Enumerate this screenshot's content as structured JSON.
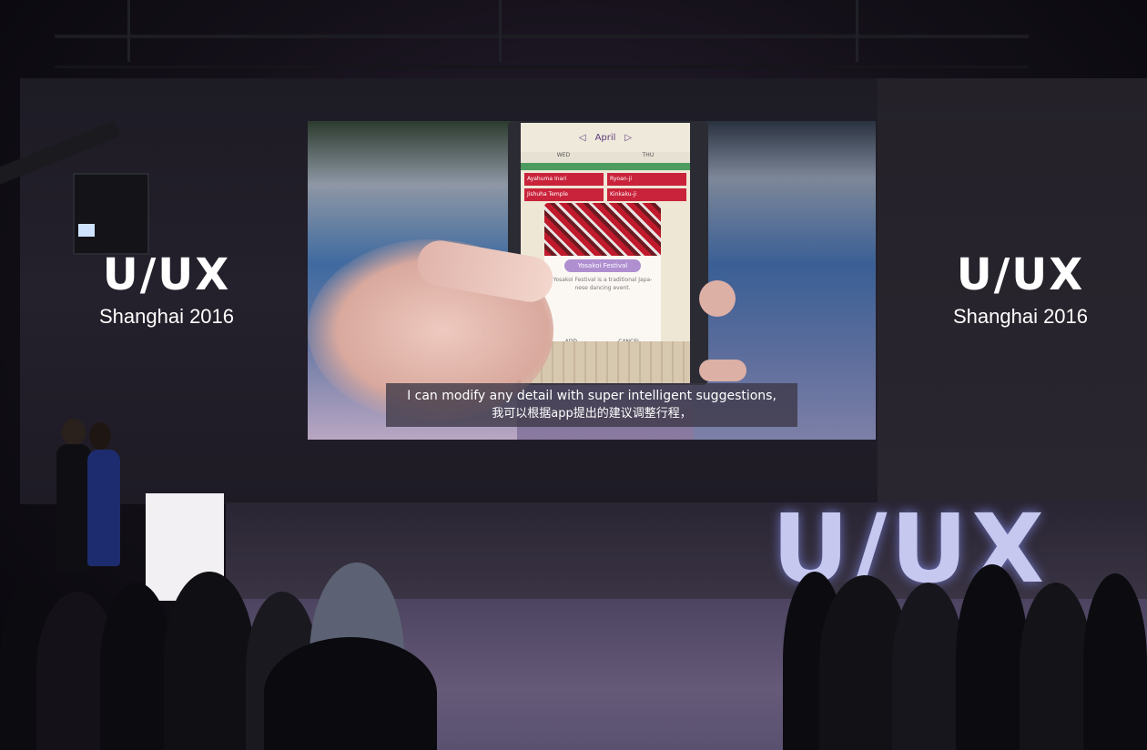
{
  "event": {
    "logo_text": "U/UX",
    "subtitle_left": "Shanghai 2016",
    "subtitle_right": "Shanghai 2016"
  },
  "video": {
    "caption_en": "I can modify any detail with super intelligent suggestions,",
    "caption_cn": "我可以根据app提出的建议调整行程，"
  },
  "phone_app": {
    "month": "April",
    "days": [
      "WED",
      "THU"
    ],
    "rows": [
      [
        "Ayahuma Inari",
        "Ryoan-ji"
      ],
      [
        "Jishuha Temple",
        "Kinkaku-ji"
      ]
    ],
    "event_title": "Yosakoi Festival",
    "event_lines": [
      "Yosakoi Festival is a traditional Japa-",
      "nese dancing event."
    ],
    "actions": [
      "ADD",
      "CANCEL"
    ]
  },
  "stage": {
    "big_logo": "U/UX"
  },
  "colors": {
    "accent": "#b08fd0",
    "event_red": "#c9233b",
    "stage_logo": "#c6c8f0"
  }
}
